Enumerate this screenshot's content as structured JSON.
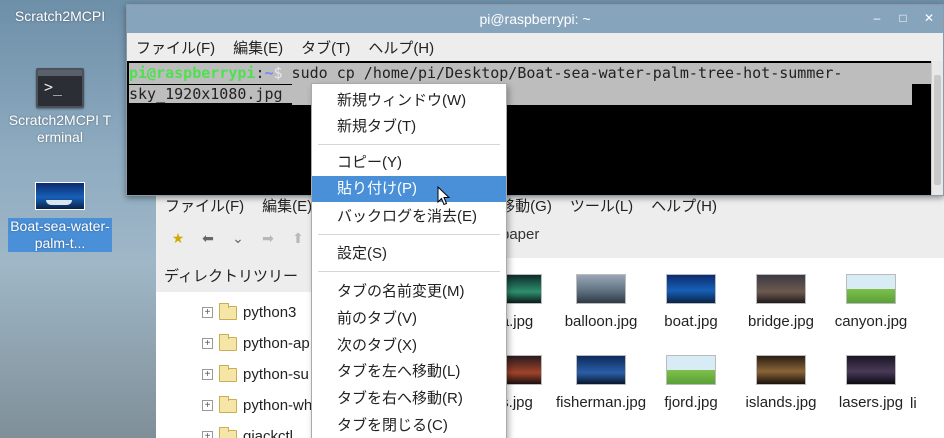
{
  "desktop": {
    "icons": [
      {
        "label": "Scratch2MCPI"
      },
      {
        "label": "Scratch2MCPI Terminal"
      },
      {
        "label": "Boat-sea-water-palm-t..."
      }
    ]
  },
  "terminal": {
    "title": "pi@raspberrypi: ~",
    "menu": [
      "ファイル(F)",
      "編集(E)",
      "タブ(T)",
      "ヘルプ(H)"
    ],
    "prompt_user": "pi@raspberrypi",
    "prompt_path": "~",
    "prompt_symbol": "$",
    "command_line1": " sudo cp /home/pi/Desktop/Boat-sea-water-palm-tree-hot-summer-",
    "command_line2": "sky_1920x1080.jpg "
  },
  "context_menu": {
    "items": [
      {
        "label": "新規ウィンドウ(W)"
      },
      {
        "label": "新規タブ(T)"
      },
      {
        "label": "コピー(Y)"
      },
      {
        "label": "貼り付け(P)"
      },
      {
        "label": "バックログを消去(E)"
      },
      {
        "label": "設定(S)"
      },
      {
        "label": "タブの名前変更(M)"
      },
      {
        "label": "前のタブ(V)"
      },
      {
        "label": "次のタブ(X)"
      },
      {
        "label": "タブを左へ移動(L)"
      },
      {
        "label": "タブを右へ移動(R)"
      },
      {
        "label": "タブを閉じる(C)"
      }
    ],
    "highlighted": "貼り付け(P)"
  },
  "file_manager": {
    "menu": [
      "ファイル(F)",
      "編集(E)",
      "移動(G)",
      "ツール(L)",
      "ヘルプ(H)"
    ],
    "path_fragment": "paper",
    "tree_header": "ディレクトリツリー",
    "tree_items": [
      "python3",
      "python-ap",
      "python-su",
      "python-wh",
      "qjackctl"
    ],
    "files_row1": [
      "a.jpg",
      "balloon.jpg",
      "boat.jpg",
      "bridge.jpg",
      "canyon.jpg"
    ],
    "files_row2": [
      "s.jpg",
      "fisherman.jpg",
      "fjord.jpg",
      "islands.jpg",
      "lasers.jpg",
      "li"
    ],
    "colors": {
      "selection": "#4a90d9",
      "titlebar": "#87a4bd"
    }
  }
}
